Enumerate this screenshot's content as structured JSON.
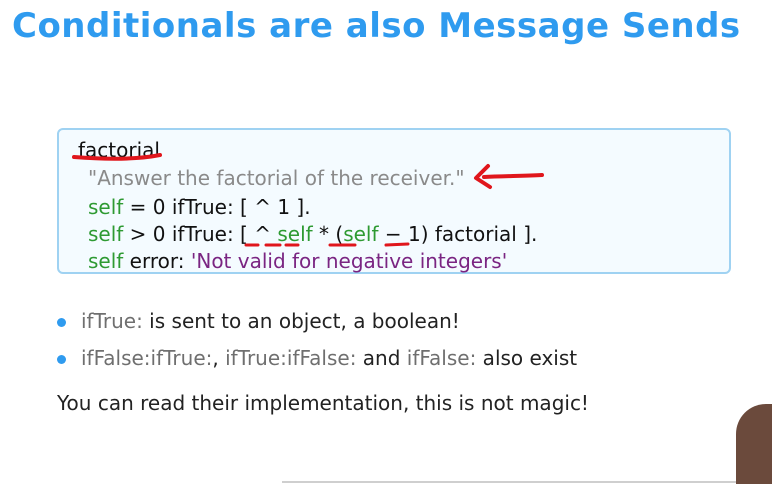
{
  "slide": {
    "title": "Conditionals are also Message Sends"
  },
  "code": {
    "method_name": "factorial",
    "comment": "\"Answer the factorial of the receiver.\"",
    "line1": {
      "receiver": "self",
      "rest": " = 0 ifTrue: [ ^ 1 ]."
    },
    "line2": {
      "receiver": "self",
      "part1": " > 0 ifTrue: [ ^ ",
      "self2": "self",
      "part2": " * (",
      "self3": "self",
      "part3": " − 1) factorial ]."
    },
    "line3": {
      "receiver": "self",
      "part1": " error: ",
      "string": "'Not valid for negative integers'"
    }
  },
  "bullets": [
    {
      "keyword": "ifTrue:",
      "text": " is sent to an object, a boolean!"
    },
    {
      "kw1": "ifFalse:ifTrue:",
      "sep1": ", ",
      "kw2": "ifTrue:ifFalse:",
      "sep2": " and ",
      "kw3": "ifFalse:",
      "tail": " also exist"
    }
  ],
  "footer_text": "You can read their implementation, this is not magic!",
  "colors": {
    "title": "#2f9bef",
    "self": "#2e9a32",
    "comment": "#8a8a8a",
    "string": "#7a2582",
    "annotation": "#e0161c",
    "box_border": "#9fd2f2"
  }
}
